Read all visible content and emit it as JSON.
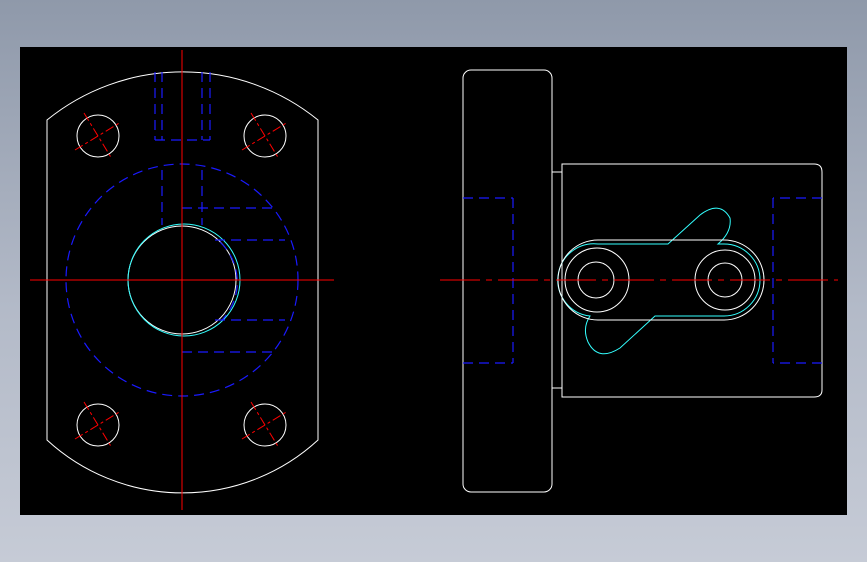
{
  "drawing": {
    "background": "#000000",
    "colors": {
      "outline": "#ffffff",
      "hidden": "#1a1aff",
      "center": "#ff0000",
      "highlight": "#33ffff",
      "page_gradient_top": "#8f99aa",
      "page_gradient_bottom": "#c6cbd6"
    },
    "views": [
      {
        "name": "front-view"
      },
      {
        "name": "side-view"
      }
    ]
  }
}
